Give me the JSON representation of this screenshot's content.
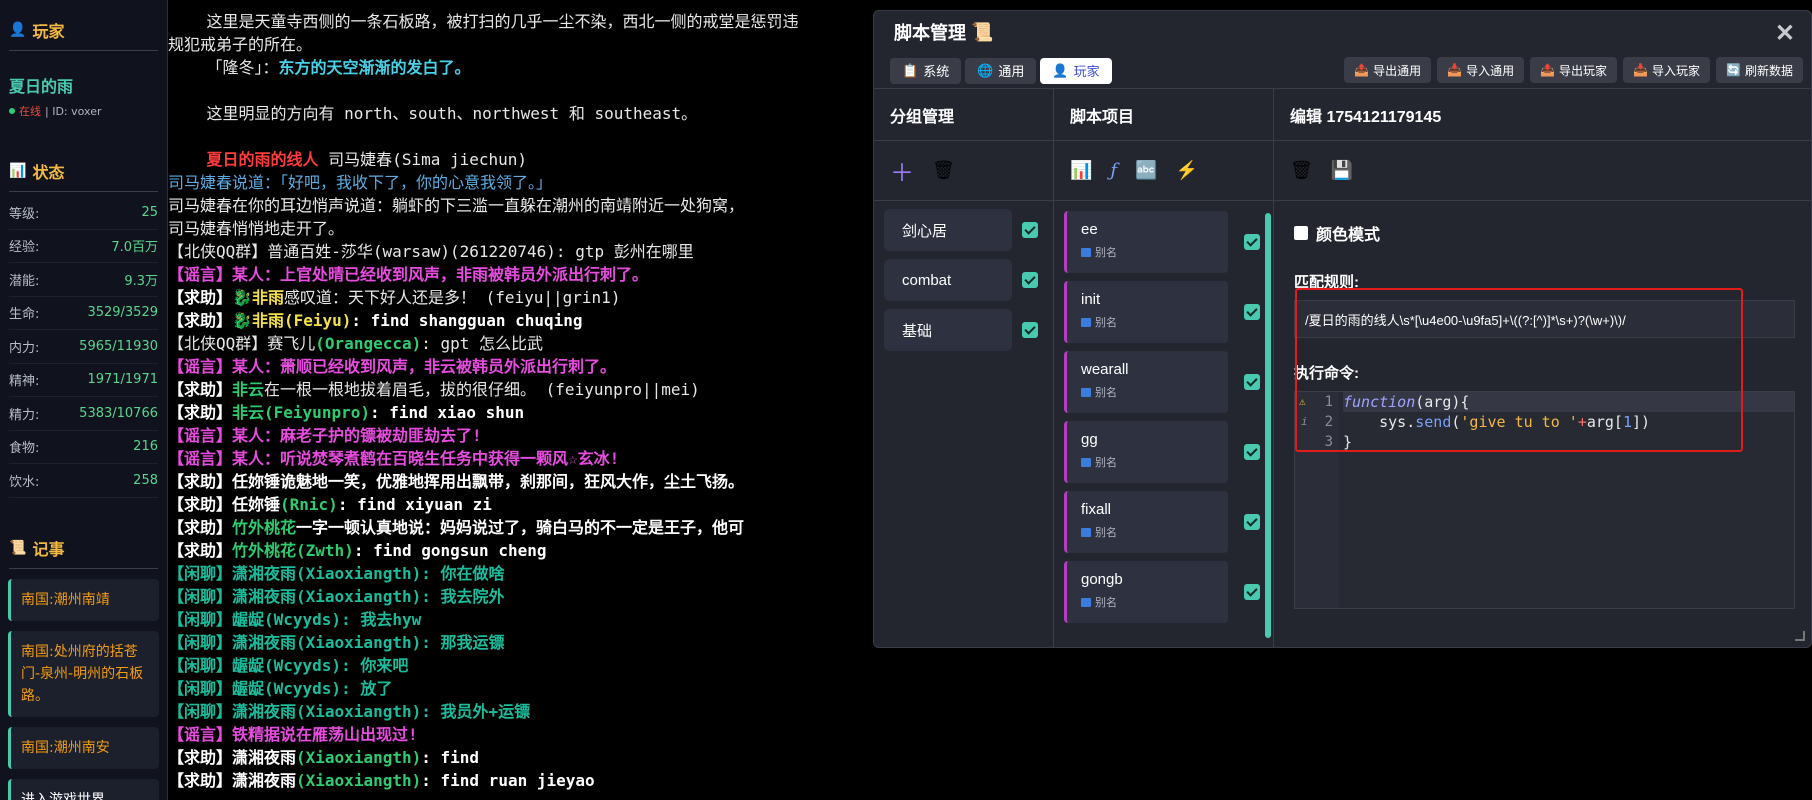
{
  "sidebar": {
    "player_title": "玩家",
    "player_name": "夏日的雨",
    "status_online": "在线",
    "status_id": "| ID: voxer",
    "stats_title": "状态",
    "stats": [
      {
        "k": "等级:",
        "v": "25"
      },
      {
        "k": "经验:",
        "v": "7.0百万"
      },
      {
        "k": "潜能:",
        "v": "9.3万"
      },
      {
        "k": "生命:",
        "v": "3529/3529"
      },
      {
        "k": "内力:",
        "v": "5965/11930"
      },
      {
        "k": "精神:",
        "v": "1971/1971"
      },
      {
        "k": "精力:",
        "v": "5383/10766"
      },
      {
        "k": "食物:",
        "v": "216"
      },
      {
        "k": "饮水:",
        "v": "258"
      }
    ],
    "notes_title": "记事",
    "notes": [
      "南国:潮州南靖",
      "南国:处州府的括苍门-泉州-明州的石板路。",
      "南国:潮州南安",
      "进入游戏世界"
    ]
  },
  "terminal": {
    "lines": [
      [
        {
          "t": "    这里是天童寺西侧的一条石板路，被打扫的几乎一尘不染，西北一侧的戒堂是惩罚违",
          "c": "c-w"
        }
      ],
      [
        {
          "t": "规犯戒弟子的所在。",
          "c": "c-w"
        }
      ],
      [
        {
          "t": "    「隆冬」：",
          "c": "c-w"
        },
        {
          "t": "东方的天空渐渐的发白了。",
          "c": "c-cb"
        }
      ],
      [
        {
          "t": "",
          "c": "c-w"
        }
      ],
      [
        {
          "t": "    这里明显的方向有 north、south、northwest 和 southeast。",
          "c": "c-w"
        }
      ],
      [
        {
          "t": "",
          "c": "c-w"
        }
      ],
      [
        {
          "t": "    ",
          "c": "c-w"
        },
        {
          "t": "夏日的雨的线人",
          "c": "c-r"
        },
        {
          "t": " 司马婕春(Sima jiechun)",
          "c": "c-w"
        }
      ],
      [
        {
          "t": "司马婕春说道：「好吧，我收下了，你的心意我领了。」",
          "c": "c-cy"
        }
      ],
      [
        {
          "t": "司马婕春在你的耳边悄声说道：躺虾的下三滥一直躲在潮州的南靖附近一处狗窝，",
          "c": "c-w"
        }
      ],
      [
        {
          "t": "司马婕春悄悄地走开了。",
          "c": "c-w"
        }
      ],
      [
        {
          "t": "【北侠QQ群】普通百姓-莎华(warsaw)(261220746): gtp 彭州在哪里",
          "c": "c-w"
        }
      ],
      [
        {
          "t": "【谣言】某人：上官处晴已经收到风声，非雨被韩员外派出行刺了。",
          "c": "c-m"
        }
      ],
      [
        {
          "t": "【求助】",
          "c": "c-b"
        },
        {
          "t": "🐉非雨",
          "c": "c-y"
        },
        {
          "t": "感叹道：天下好人还是多！ (feiyu||grin1)",
          "c": "c-w"
        }
      ],
      [
        {
          "t": "【求助】",
          "c": "c-b"
        },
        {
          "t": "🐉非雨(Feiyu)",
          "c": "c-y"
        },
        {
          "t": ": find shangguan chuqing",
          "c": "c-b"
        }
      ],
      [
        {
          "t": "【北侠QQ群】赛飞儿",
          "c": "c-w"
        },
        {
          "t": "(Orangecca)",
          "c": "c-g"
        },
        {
          "t": ": gpt 怎么比武",
          "c": "c-w"
        }
      ],
      [
        {
          "t": "【谣言】某人：萧顺已经收到风声，非云被韩员外派出行刺了。",
          "c": "c-m"
        }
      ],
      [
        {
          "t": "【求助】",
          "c": "c-b"
        },
        {
          "t": "非云",
          "c": "c-g"
        },
        {
          "t": "在一根一根地拔着眉毛，拔的很仔细。 (feiyunpro||mei)",
          "c": "c-w"
        }
      ],
      [
        {
          "t": "【求助】",
          "c": "c-b"
        },
        {
          "t": "非云(Feiyunpro)",
          "c": "c-g"
        },
        {
          "t": ": find xiao shun",
          "c": "c-b"
        }
      ],
      [
        {
          "t": "【谣言】某人：麻老子护的镖被劫匪劫去了!",
          "c": "c-m"
        }
      ],
      [
        {
          "t": "【谣言】某人：听说焚琴煮鹤在百晓生任务中获得一颗风☆玄冰!",
          "c": "c-m"
        }
      ],
      [
        {
          "t": "【求助】任妳锤诡魅地一笑，优雅地挥用出飘带，刹那间，狂风大作，尘土飞扬。",
          "c": "c-b"
        }
      ],
      [
        {
          "t": "【求助】任妳锤",
          "c": "c-b"
        },
        {
          "t": "(Rnic)",
          "c": "c-g"
        },
        {
          "t": ": find xiyuan zi",
          "c": "c-b"
        }
      ],
      [
        {
          "t": "【求助】",
          "c": "c-b"
        },
        {
          "t": "竹外桃花",
          "c": "c-g"
        },
        {
          "t": "一字一顿认真地说：妈妈说过了，骑白马的不一定是王子，他可",
          "c": "c-b"
        }
      ],
      [
        {
          "t": "【求助】",
          "c": "c-b"
        },
        {
          "t": "竹外桃花(Zwth)",
          "c": "c-g"
        },
        {
          "t": ": find gongsun cheng",
          "c": "c-b"
        }
      ],
      [
        {
          "t": "【闲聊】潇湘夜雨(Xiaoxiangth): 你在做啥",
          "c": "c-t"
        }
      ],
      [
        {
          "t": "【闲聊】潇湘夜雨(Xiaoxiangth): 我去院外",
          "c": "c-t"
        }
      ],
      [
        {
          "t": "【闲聊】龌龊(Wcyyds): 我去hyw",
          "c": "c-t"
        }
      ],
      [
        {
          "t": "【闲聊】潇湘夜雨(Xiaoxiangth): 那我运镖",
          "c": "c-t"
        }
      ],
      [
        {
          "t": "【闲聊】龌龊(Wcyyds): 你来吧",
          "c": "c-t"
        }
      ],
      [
        {
          "t": "【闲聊】龌龊(Wcyyds): 放了",
          "c": "c-t"
        }
      ],
      [
        {
          "t": "【闲聊】潇湘夜雨(Xiaoxiangth): 我员外+运镖",
          "c": "c-t"
        }
      ],
      [
        {
          "t": "【谣言】铁精据说在雁荡山出现过!",
          "c": "c-m"
        }
      ],
      [
        {
          "t": "【求助】潇湘夜雨",
          "c": "c-b"
        },
        {
          "t": "(Xiaoxiangth)",
          "c": "c-g"
        },
        {
          "t": ": find",
          "c": "c-b"
        }
      ],
      [
        {
          "t": "【求助】潇湘夜雨",
          "c": "c-b"
        },
        {
          "t": "(Xiaoxiangth)",
          "c": "c-g"
        },
        {
          "t": ": find ruan jieyao",
          "c": "c-b"
        }
      ]
    ]
  },
  "panel": {
    "title": "脚本管理",
    "close": "✕",
    "tabs": [
      "系统",
      "通用",
      "玩家"
    ],
    "tab_icons": [
      "📋",
      "🌐",
      "👤"
    ],
    "actions": [
      "导出通用",
      "导入通用",
      "导出玩家",
      "导入玩家",
      "刷新数据"
    ],
    "col1_title": "分组管理",
    "col2_title": "脚本项目",
    "col3_title": "编辑 1754121179145",
    "groups": [
      "剑心居",
      "combat",
      "基础"
    ],
    "items": [
      "ee",
      "init",
      "wearall",
      "gg",
      "fixall",
      "gongb"
    ],
    "alias": "别名",
    "color_mode": "颜色模式",
    "rule_label": "匹配规则:",
    "rule_value": "/夏日的雨的线人\\s*[\\u4e00-\\u9fa5]+\\((?:[^)]*\\s+)?(\\w+)\\)/",
    "cmd_label": "执行命令:",
    "code_lines": [
      "function(arg){",
      "    sys.send('give tu to '+arg[1])",
      "}"
    ],
    "line_numbers": [
      "1",
      "2",
      "3"
    ],
    "accent": "#48c9b0",
    "highlight": "#e21b1b"
  }
}
